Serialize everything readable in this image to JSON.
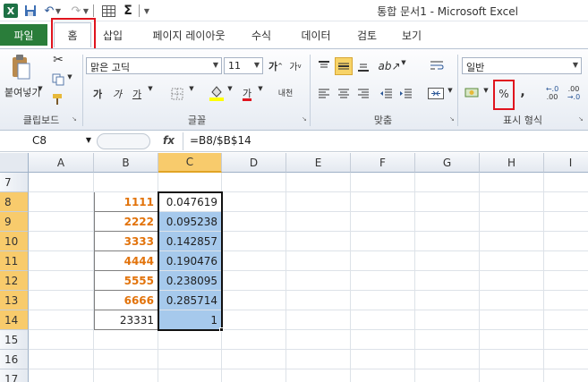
{
  "window": {
    "title": "통합 문서1 - Microsoft Excel"
  },
  "quick_access": {
    "icons": [
      "excel-logo-icon",
      "save-icon",
      "undo-icon",
      "redo-icon",
      "table-icon",
      "sigma-icon",
      "customize-icon"
    ]
  },
  "tabs": {
    "file": "파일",
    "items": [
      "홈",
      "삽입",
      "페이지 레이아웃",
      "수식",
      "데이터",
      "검토",
      "보기"
    ],
    "active": "홈"
  },
  "ribbon": {
    "clipboard": {
      "paste_label": "붙여넣기",
      "group_label": "클립보드"
    },
    "font": {
      "font_name": "맑은 고딕",
      "font_size": "11",
      "group_label": "글꼴",
      "bold": "가",
      "italic": "가",
      "underline": "가",
      "font_color_letter": "가",
      "phonetic": "내천"
    },
    "alignment": {
      "group_label": "맞춤"
    },
    "number": {
      "format": "일반",
      "group_label": "표시 형식",
      "percent": "%",
      "comma": ",",
      "inc_decimal": ".00",
      "dec_decimal": ".0"
    }
  },
  "formula_bar": {
    "name_box": "C8",
    "fx": "fx",
    "formula": "=B8/$B$14"
  },
  "columns": [
    "A",
    "B",
    "C",
    "D",
    "E",
    "F",
    "G",
    "H",
    "I"
  ],
  "selected_column": "C",
  "rows": [
    {
      "num": "7",
      "b": "",
      "c": ""
    },
    {
      "num": "8",
      "b": "1111",
      "c": "0.047619"
    },
    {
      "num": "9",
      "b": "2222",
      "c": "0.095238"
    },
    {
      "num": "10",
      "b": "3333",
      "c": "0.142857"
    },
    {
      "num": "11",
      "b": "4444",
      "c": "0.190476"
    },
    {
      "num": "12",
      "b": "5555",
      "c": "0.238095"
    },
    {
      "num": "13",
      "b": "6666",
      "c": "0.285714"
    },
    {
      "num": "14",
      "b": "23331",
      "c": "1"
    },
    {
      "num": "15",
      "b": "",
      "c": ""
    },
    {
      "num": "16",
      "b": "",
      "c": ""
    },
    {
      "num": "17",
      "b": "",
      "c": ""
    }
  ],
  "colors": {
    "file_tab": "#2a7d3a",
    "highlight": "#e0141e",
    "bold_values": "#e2730b",
    "selection": "#a6c9ec",
    "header_selected": "#f8cb6c"
  }
}
